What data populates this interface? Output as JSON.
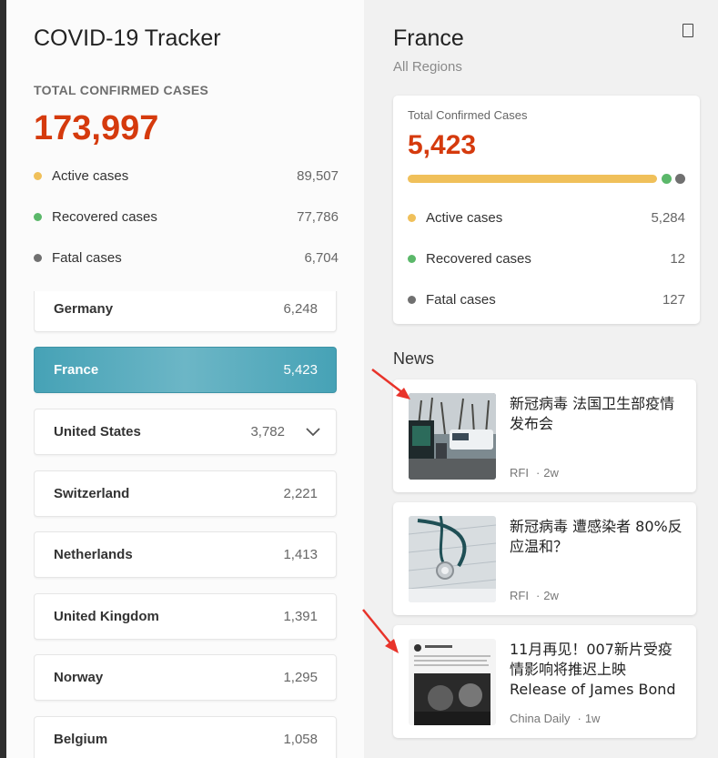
{
  "app": {
    "title": "COVID-19 Tracker"
  },
  "totals": {
    "label": "TOTAL CONFIRMED CASES",
    "value": "173,997",
    "stats": [
      {
        "label": "Active cases",
        "value": "89,507",
        "color": "#f0c05a"
      },
      {
        "label": "Recovered cases",
        "value": "77,786",
        "color": "#5bb86a"
      },
      {
        "label": "Fatal cases",
        "value": "6,704",
        "color": "#707070"
      }
    ]
  },
  "countries": [
    {
      "name": "Germany",
      "value": "6,248"
    },
    {
      "name": "France",
      "value": "5,423",
      "selected": true
    },
    {
      "name": "United States",
      "value": "3,782",
      "expandable": true
    },
    {
      "name": "Switzerland",
      "value": "2,221"
    },
    {
      "name": "Netherlands",
      "value": "1,413"
    },
    {
      "name": "United Kingdom",
      "value": "1,391"
    },
    {
      "name": "Norway",
      "value": "1,295"
    },
    {
      "name": "Belgium",
      "value": "1,058"
    }
  ],
  "detail": {
    "title": "France",
    "subtitle": "All Regions",
    "card": {
      "label": "Total Confirmed Cases",
      "value": "5,423",
      "stats": [
        {
          "label": "Active cases",
          "value": "5,284",
          "color": "#f0c05a"
        },
        {
          "label": "Recovered cases",
          "value": "12",
          "color": "#5bb86a"
        },
        {
          "label": "Fatal cases",
          "value": "127",
          "color": "#707070"
        }
      ]
    }
  },
  "news": {
    "heading": "News",
    "items": [
      {
        "title": "新冠病毒 法国卫生部疫情发布会",
        "source": "RFI",
        "age": "2w"
      },
      {
        "title": "新冠病毒 遭感染者 80%反应温和？",
        "source": "RFI",
        "age": "2w"
      },
      {
        "title": "11月再见！007新片受疫情影响将推迟上映 Release of James Bond",
        "source": "China Daily",
        "age": "1w"
      }
    ]
  }
}
